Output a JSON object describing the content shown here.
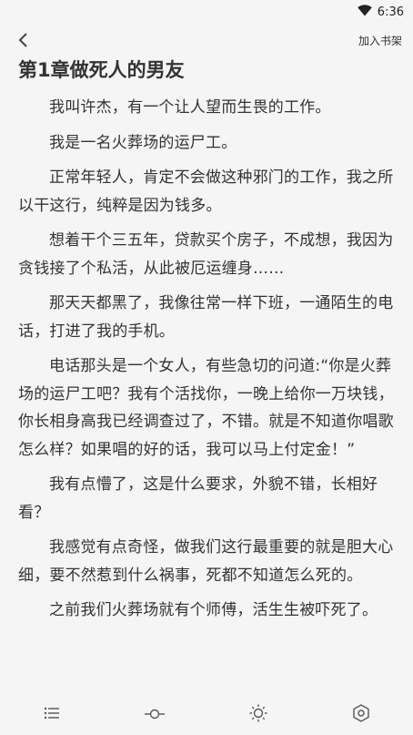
{
  "status_bar": {
    "time": "6:36",
    "icons": [
      "wifi-icon"
    ]
  },
  "top_bar": {
    "back_icon": "chevron-left-icon",
    "add_shelf_label": "加入书架"
  },
  "chapter": {
    "title": "第1章做死人的男友",
    "paragraphs": [
      "我叫许杰，有一个让人望而生畏的工作。",
      "我是一名火葬场的运尸工。",
      "正常年轻人，肯定不会做这种邪门的工作，我之所以干这行，纯粹是因为钱多。",
      "想着干个三五年，贷款买个房子，不成想，我因为贪钱接了个私活，从此被厄运缠身……",
      "那天天都黑了，我像往常一样下班，一通陌生的电话，打进了我的手机。",
      "电话那头是一个女人，有些急切的问道:“你是火葬场的运尸工吧？我有个活找你，一晚上给你一万块钱，你长相身高我已经调查过了，不错。就是不知道你唱歌怎么样？如果唱的好的话，我可以马上付定金！”",
      "我有点懵了，这是什么要求，外貌不错，长相好看？",
      "我感觉有点奇怪，做我们这行最重要的就是胆大心细，要不然惹到什么祸事，死都不知道怎么死的。",
      "之前我们火葬场就有个师傅，活生生被吓死了。"
    ]
  },
  "bottom_bar": {
    "icons": [
      "menu-list-icon",
      "progress-icon",
      "brightness-icon",
      "settings-icon"
    ]
  }
}
